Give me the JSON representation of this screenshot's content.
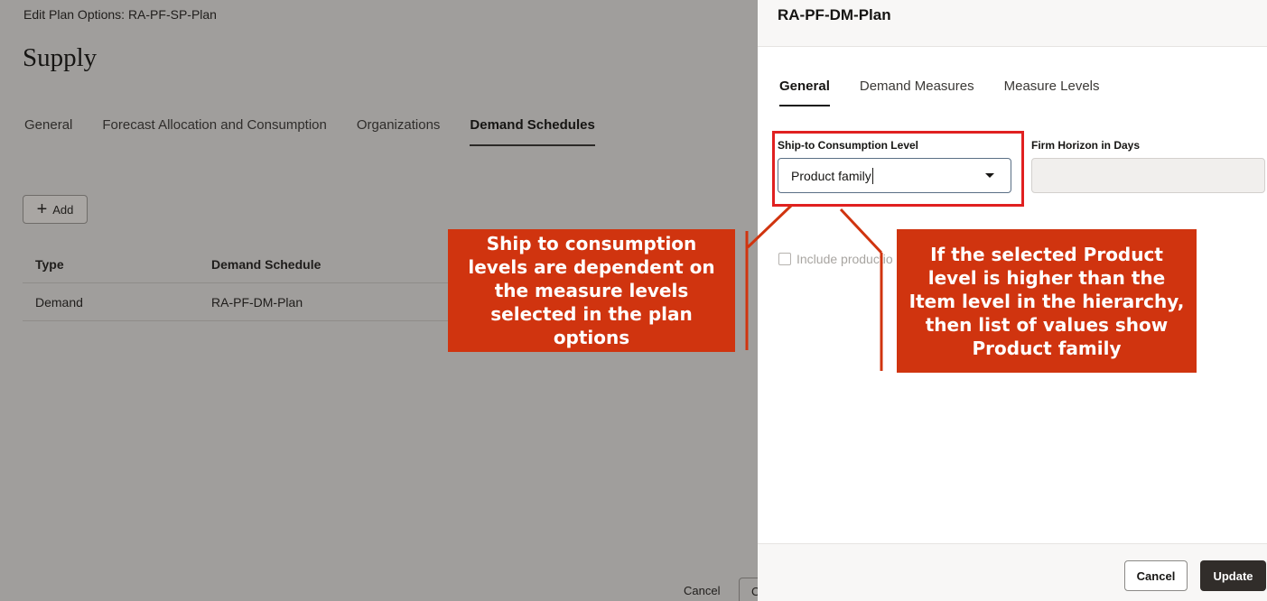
{
  "background_page": {
    "header": "Edit Plan Options: RA-PF-SP-Plan",
    "title": "Supply",
    "tabs": [
      {
        "label": "General"
      },
      {
        "label": "Forecast Allocation and Consumption"
      },
      {
        "label": "Organizations"
      },
      {
        "label": "Demand Schedules",
        "selected": true
      }
    ],
    "add_label": "Add",
    "table": {
      "headers": [
        "Type",
        "Demand Schedule"
      ],
      "rows": [
        [
          "Demand",
          "RA-PF-DM-Plan"
        ]
      ]
    },
    "footer_cancel": "Cancel",
    "footer_partial": "C"
  },
  "drawer": {
    "title": "RA-PF-DM-Plan",
    "tabs": [
      {
        "label": "General",
        "selected": true
      },
      {
        "label": "Demand Measures"
      },
      {
        "label": "Measure Levels"
      }
    ],
    "ship_to_label": "Ship-to Consumption Level",
    "ship_to_value": "Product family",
    "firm_horizon_label": "Firm Horizon in Days",
    "firm_horizon_value": "",
    "checkbox_label": "Include productio",
    "cancel_label": "Cancel",
    "update_label": "Update"
  },
  "callouts": {
    "left": "Ship to consumption levels are dependent on the measure levels selected in the plan options",
    "right": "If the selected Product level is higher than the Item level in the hierarchy, then list of values show Product family"
  },
  "colors": {
    "callout": "#d0340f",
    "highlight": "#e02020",
    "update_button": "#312d2a"
  }
}
